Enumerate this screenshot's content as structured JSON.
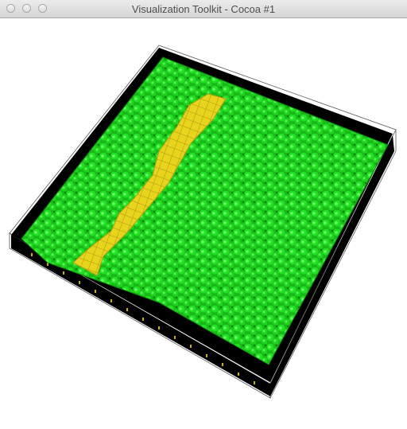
{
  "window": {
    "title": "Visualization Toolkit - Cocoa #1"
  },
  "scene": {
    "surface_color": "#1ed21e",
    "stripe_color": "#e6d21e",
    "wall_color": "#000000",
    "background": "#ffffff"
  }
}
